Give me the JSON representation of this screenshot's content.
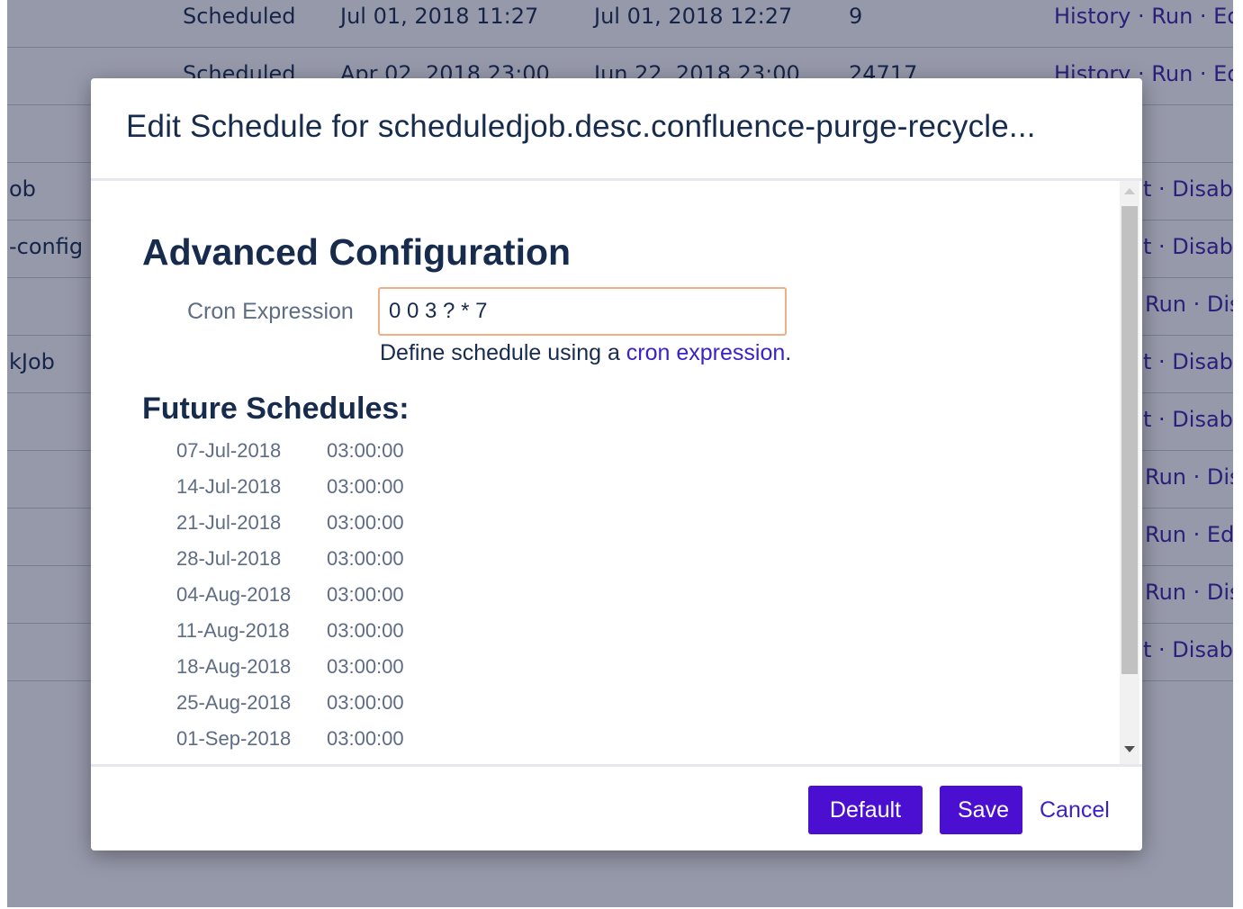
{
  "background_rows": [
    {
      "name": "",
      "status": "Scheduled",
      "last_run": "Jul 01, 2018 11:27",
      "next_run": "Jul 01, 2018 12:27",
      "duration": "9",
      "actions": "History · Run · Edi"
    },
    {
      "name": "",
      "status": "Scheduled",
      "last_run": "Apr 02, 2018 23:00",
      "next_run": "Jun 22, 2018 23:00",
      "duration": "24717",
      "actions": "History · Run · Edi"
    },
    {
      "name": "",
      "actions": ""
    },
    {
      "name": "ob",
      "actions": "t · Disabl"
    },
    {
      "name": "-config",
      "actions": "t · Disabl"
    },
    {
      "name": "",
      "actions": "Run · Dis"
    },
    {
      "name": "kJob",
      "actions": "t · Disabl"
    },
    {
      "name": "",
      "actions": "t · Disabl"
    },
    {
      "name": "",
      "actions": "Run · Dis"
    },
    {
      "name": "",
      "actions": "Run · Edi"
    },
    {
      "name": "",
      "actions": "Run · Dis"
    },
    {
      "name": "",
      "actions": "t · Disabl"
    }
  ],
  "modal": {
    "title": "Edit Schedule for scheduledjob.desc.confluence-purge-recycle...",
    "section_heading": "Advanced Configuration",
    "cron_label": "Cron Expression",
    "cron_value": "0 0 3 ? * 7",
    "help_prefix": "Define schedule using a ",
    "help_link": "cron expression",
    "help_suffix": ".",
    "future_heading": "Future Schedules:",
    "future_schedules": [
      {
        "date": "07-Jul-2018",
        "time": "03:00:00"
      },
      {
        "date": "14-Jul-2018",
        "time": "03:00:00"
      },
      {
        "date": "21-Jul-2018",
        "time": "03:00:00"
      },
      {
        "date": "28-Jul-2018",
        "time": "03:00:00"
      },
      {
        "date": "04-Aug-2018",
        "time": "03:00:00"
      },
      {
        "date": "11-Aug-2018",
        "time": "03:00:00"
      },
      {
        "date": "18-Aug-2018",
        "time": "03:00:00"
      },
      {
        "date": "25-Aug-2018",
        "time": "03:00:00"
      },
      {
        "date": "01-Sep-2018",
        "time": "03:00:00"
      }
    ],
    "buttons": {
      "default": "Default",
      "save": "Save",
      "cancel": "Cancel"
    }
  },
  "colors": {
    "primary": "#4b0fd1",
    "link": "#3b22c8",
    "overlay": "#5a5f7e",
    "input_focus_border": "#f0ae86"
  }
}
